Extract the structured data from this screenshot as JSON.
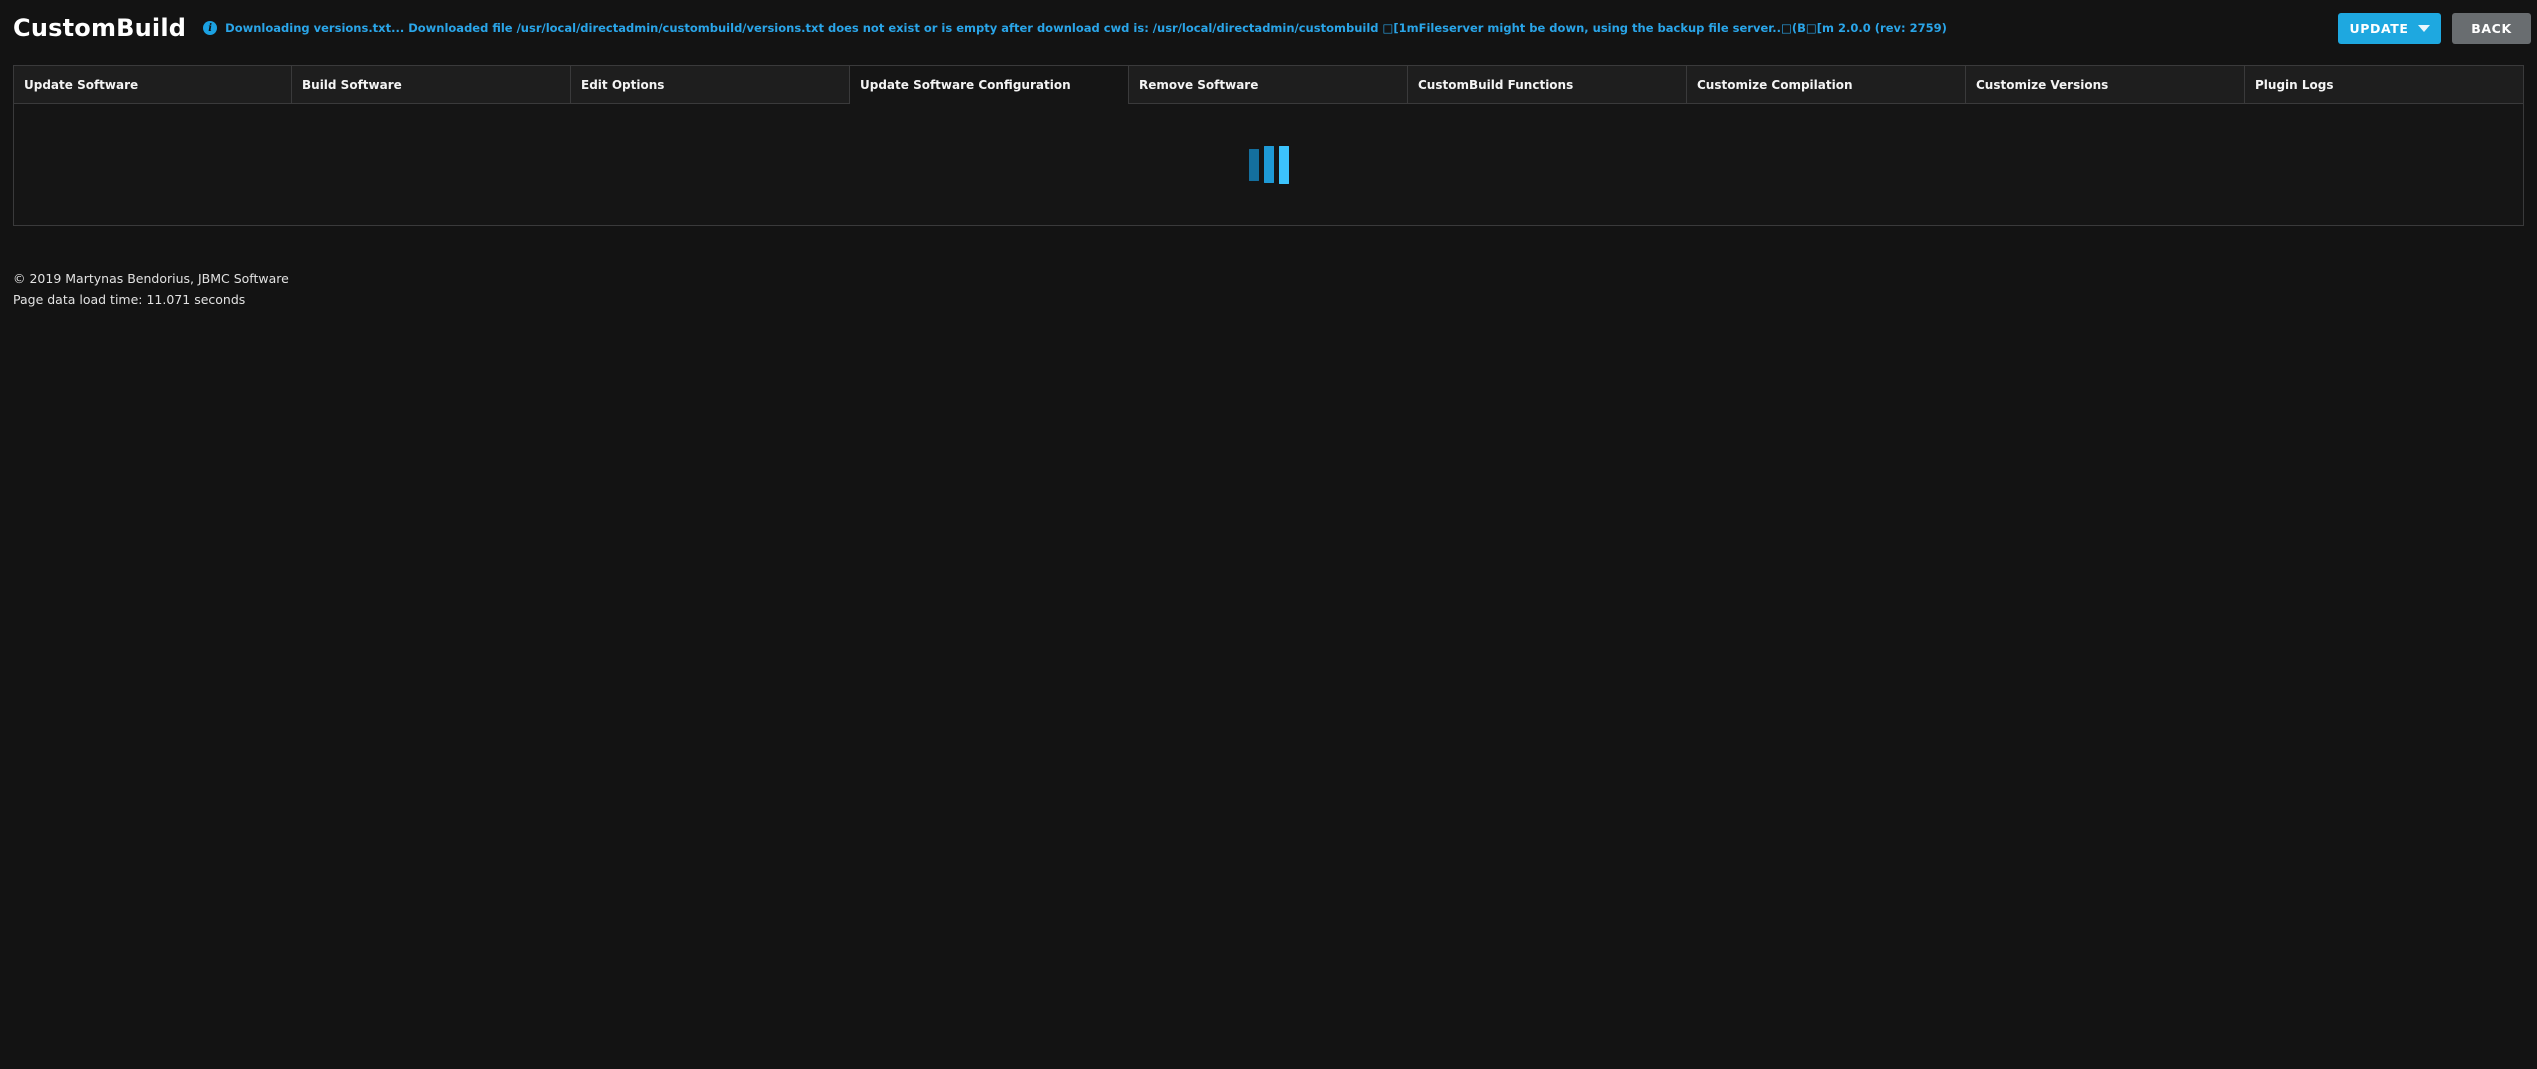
{
  "page": {
    "title": "CustomBuild"
  },
  "header": {
    "status_message": "Downloading versions.txt... Downloaded file /usr/local/directadmin/custombuild/versions.txt does not exist or is empty after download cwd is: /usr/local/directadmin/custombuild □[1mFileserver might be down, using the backup file server..□(B□[m 2.0.0 (rev: 2759)",
    "info_icon_glyph": "i",
    "update_button_label": "UPDATE",
    "back_button_label": "BACK"
  },
  "tabs": [
    {
      "label": "Update Software",
      "active": false
    },
    {
      "label": "Build Software",
      "active": false
    },
    {
      "label": "Edit Options",
      "active": false
    },
    {
      "label": "Update Software Configuration",
      "active": true
    },
    {
      "label": "Remove Software",
      "active": false
    },
    {
      "label": "CustomBuild Functions",
      "active": false
    },
    {
      "label": "Customize Compilation",
      "active": false
    },
    {
      "label": "Customize Versions",
      "active": false
    },
    {
      "label": "Plugin Logs",
      "active": false
    }
  ],
  "content": {
    "loader_icon": "three-bars-loading-indicator"
  },
  "footer": {
    "copyright": "© 2019 Martynas Bendorius, JBMC Software",
    "load_time": "Page data load time: 11.071 seconds"
  },
  "colors": {
    "page_background": "#131313",
    "accent_blue": "#1ea8e0",
    "message_blue": "#2aa5e8",
    "button_gray": "#696d70",
    "tab_background": "#1e1e1e",
    "panel_background": "#151515",
    "border": "#3a3a3b",
    "loader_bar_1": "#146f9e",
    "loader_bar_2": "#1e9ad6",
    "loader_bar_3": "#3cc3fc"
  }
}
